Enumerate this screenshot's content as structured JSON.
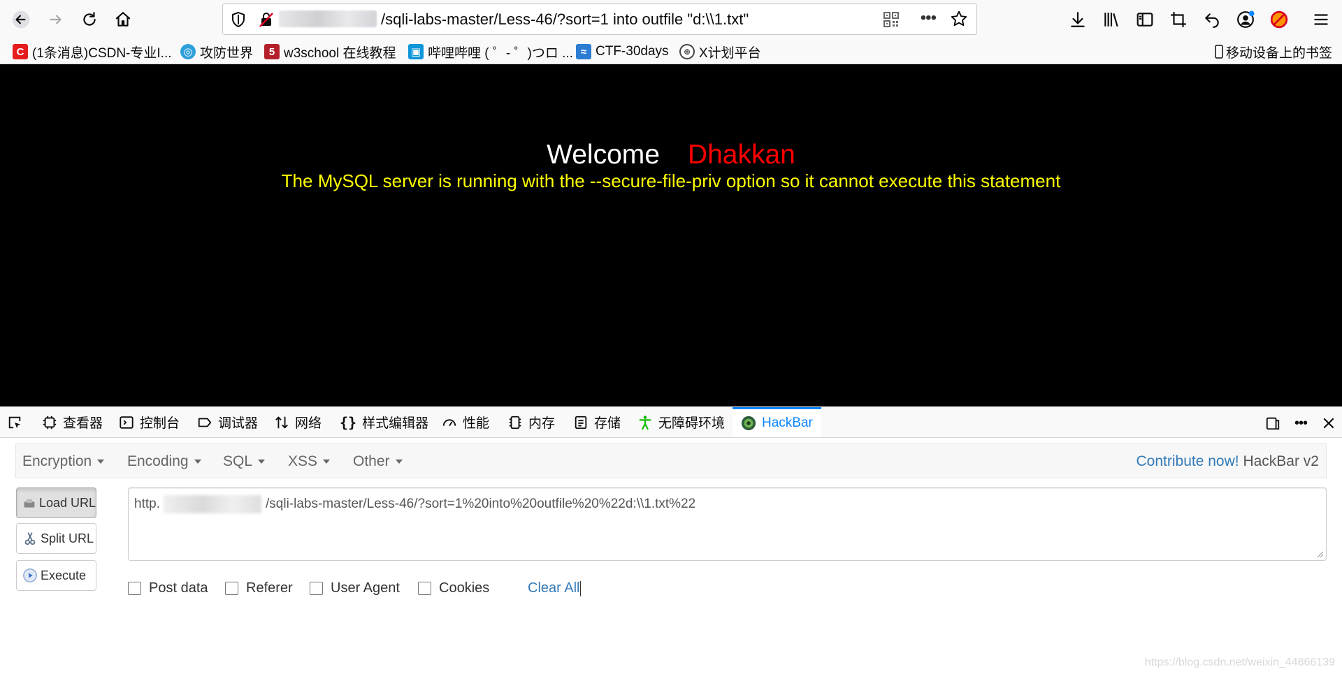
{
  "browser": {
    "url_display": "/sqli-labs-master/Less-46/?sort=1 into outfile \"d:\\\\1.txt\"",
    "nav": {
      "back_icon": "back-arrow-icon",
      "forward_icon": "forward-arrow-icon",
      "reload_icon": "reload-icon",
      "home_icon": "home-icon"
    },
    "more_label": "•••",
    "right_icons": [
      "download-icon",
      "library-icon",
      "sidebar-icon",
      "crop-icon",
      "undo-icon",
      "account-icon",
      "blocked-addon-icon",
      "menu-icon"
    ]
  },
  "bookmarks": {
    "items": [
      {
        "label": "(1条消息)CSDN-专业I...",
        "icon": "csdn-icon",
        "color": "#e41c1c"
      },
      {
        "label": "攻防世界",
        "icon": "globe-blue-icon",
        "color": "#2e9fd8"
      },
      {
        "label": "w3school 在线教程",
        "icon": "w3school-icon",
        "color": "#b4202a"
      },
      {
        "label": "哔哩哔哩 ( ゜- ゜)つロ ...",
        "icon": "bilibili-icon",
        "color": "#0d96d8"
      },
      {
        "label": "CTF-30days",
        "icon": "ctf-icon",
        "color": "#2b7cd3"
      },
      {
        "label": "X计划平台",
        "icon": "globe-icon",
        "color": "#444444"
      }
    ],
    "mobile_label": "移动设备上的书签"
  },
  "page": {
    "welcome": "Welcome",
    "name": "Dhakkan",
    "message": "The MySQL server is running with the --secure-file-priv option so it cannot execute this statement"
  },
  "devtools": {
    "tabs": [
      {
        "label": "查看器",
        "icon": "inspector-icon"
      },
      {
        "label": "控制台",
        "icon": "console-icon"
      },
      {
        "label": "调试器",
        "icon": "debugger-icon"
      },
      {
        "label": "网络",
        "icon": "network-icon"
      },
      {
        "label": "样式编辑器",
        "icon": "style-editor-icon"
      },
      {
        "label": "性能",
        "icon": "performance-icon"
      },
      {
        "label": "内存",
        "icon": "memory-icon"
      },
      {
        "label": "存储",
        "icon": "storage-icon"
      },
      {
        "label": "无障碍环境",
        "icon": "accessibility-icon"
      },
      {
        "label": "HackBar",
        "icon": "hackbar-icon",
        "active": true
      }
    ],
    "accent": "#0a84ff"
  },
  "hackbar": {
    "menu": [
      "Encryption",
      "Encoding",
      "SQL",
      "XSS",
      "Other"
    ],
    "contribute": "Contribute now!",
    "version": "HackBar v2",
    "buttons": {
      "load": "Load URL",
      "split": "Split URL",
      "execute": "Execute"
    },
    "url_prefix": "http.",
    "url_rest": "/sqli-labs-master/Less-46/?sort=1%20into%20outfile%20%22d:\\\\1.txt%22",
    "options": [
      "Post data",
      "Referer",
      "User Agent",
      "Cookies"
    ],
    "clear_all": "Clear All"
  },
  "watermark": "https://blog.csdn.net/weixin_44866139"
}
